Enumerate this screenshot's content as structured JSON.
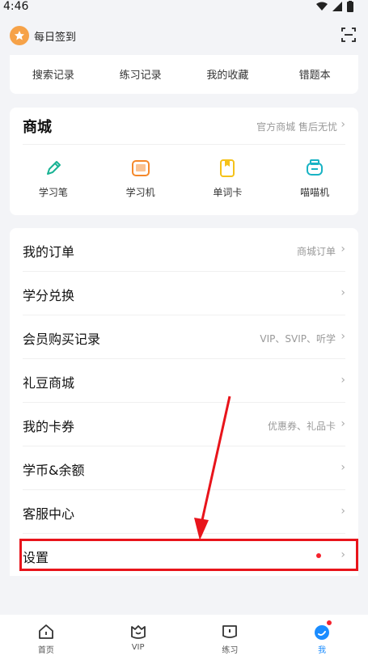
{
  "status": {
    "time": "4:46"
  },
  "topbar": {
    "checkin_label": "每日签到"
  },
  "records": {
    "items": [
      "搜索记录",
      "练习记录",
      "我的收藏",
      "错题本"
    ]
  },
  "mall": {
    "title": "商城",
    "subtitle": "官方商城 售后无忧",
    "items": [
      {
        "label": "学习笔",
        "icon": "pen-icon",
        "color": "#19b394"
      },
      {
        "label": "学习机",
        "icon": "tablet-icon",
        "color": "#f5882a"
      },
      {
        "label": "单词卡",
        "icon": "word-card-icon",
        "color": "#f5c21a"
      },
      {
        "label": "喵喵机",
        "icon": "printer-icon",
        "color": "#19b3c4"
      }
    ]
  },
  "menu": {
    "rows": [
      {
        "label": "我的订单",
        "hint": "商城订单"
      },
      {
        "label": "学分兑换",
        "hint": ""
      },
      {
        "label": "会员购买记录",
        "hint": "VIP、SVIP、听学"
      },
      {
        "label": "礼豆商城",
        "hint": ""
      },
      {
        "label": "我的卡券",
        "hint": "优惠券、礼品卡"
      },
      {
        "label": "学币&余额",
        "hint": ""
      },
      {
        "label": "客服中心",
        "hint": ""
      },
      {
        "label": "设置",
        "hint": ""
      }
    ]
  },
  "tabbar": {
    "tabs": [
      {
        "label": "首页",
        "icon": "home-icon"
      },
      {
        "label": "VIP",
        "icon": "vip-icon"
      },
      {
        "label": "练习",
        "icon": "practice-icon"
      },
      {
        "label": "我",
        "icon": "profile-icon",
        "active": true
      }
    ]
  },
  "colors": {
    "accent": "#1a8cff",
    "highlight": "#e8141b",
    "badge": "#f5222d"
  }
}
